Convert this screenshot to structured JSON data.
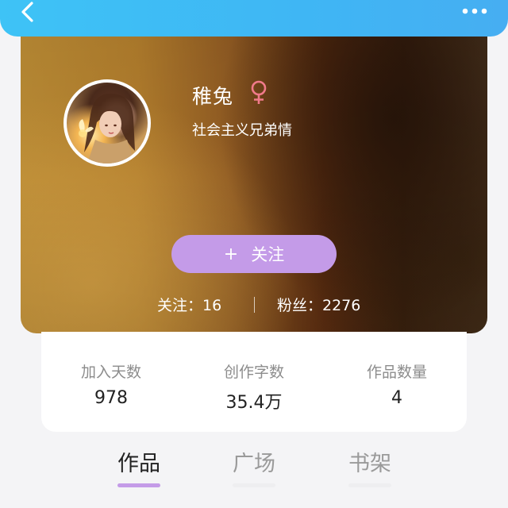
{
  "header": {
    "back_icon": "chevron-left-icon",
    "more_icon": "more-dots-icon",
    "accent_color": "#3fb8f4"
  },
  "profile": {
    "username": "稚兔",
    "gender_icon": "female-symbol-icon",
    "gender_color": "#f07a8a",
    "bio": "社会主义兄弟情",
    "follow_button": {
      "plus": "+",
      "label": "关注",
      "color": "#c49be8"
    },
    "following": "关注：16",
    "fans": "粉丝：2276"
  },
  "stats": [
    {
      "label": "加入天数",
      "value": "978"
    },
    {
      "label": "创作字数",
      "value": "35.4万"
    },
    {
      "label": "作品数量",
      "value": "4"
    }
  ],
  "tabs": [
    {
      "label": "作品",
      "active": true
    },
    {
      "label": "广场",
      "active": false
    },
    {
      "label": "书架",
      "active": false
    }
  ]
}
